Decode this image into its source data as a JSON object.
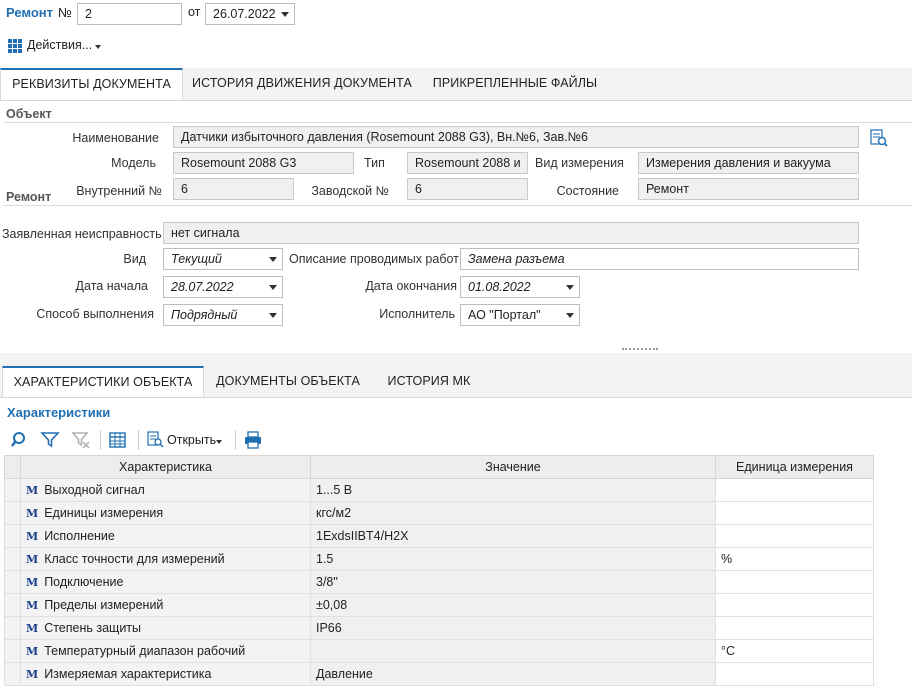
{
  "header": {
    "title": "Ремонт",
    "number_label": "№",
    "number_value": "2",
    "from_label": "от",
    "date_value": "26.07.2022",
    "actions_label": "Действия..."
  },
  "main_tabs": [
    "РЕКВИЗИТЫ ДОКУМЕНТА",
    "ИСТОРИЯ ДВИЖЕНИЯ ДОКУМЕНТА",
    "ПРИКРЕПЛЕННЫЕ ФАЙЛЫ"
  ],
  "object": {
    "section_title": "Объект",
    "name_label": "Наименование",
    "name_value": "Датчики избыточного давления (Rosemount 2088 G3), Вн.№6, Зав.№6",
    "model_label": "Модель",
    "model_value": "Rosemount 2088 G3",
    "type_label": "Тип",
    "type_value": "Rosemount 2088 и",
    "measure_label": "Вид измерения",
    "measure_value": "Измерения давления и вакуума",
    "internal_label": "Внутренний №",
    "internal_value": "6",
    "factory_label": "Заводской №",
    "factory_value": "6",
    "state_label": "Состояние",
    "state_value": "Ремонт"
  },
  "repair": {
    "section_title": "Ремонт",
    "fault_label": "Заявленная неисправность",
    "fault_value": "нет сигнала",
    "kind_label": "Вид",
    "kind_value": "Текущий",
    "work_label": "Описание проводимых работ",
    "work_value": "Замена разъема",
    "start_label": "Дата начала",
    "start_value": "28.07.2022",
    "end_label": "Дата окончания",
    "end_value": "01.08.2022",
    "method_label": "Способ выполнения",
    "method_value": "Подрядный",
    "executor_label": "Исполнитель",
    "executor_value": "АО \"Портал\""
  },
  "sub_tabs": [
    "ХАРАКТЕРИСТИКИ ОБЪЕКТА",
    "ДОКУМЕНТЫ ОБЪЕКТА",
    "ИСТОРИЯ МК"
  ],
  "characteristics": {
    "title": "Характеристики",
    "open_label": "Открыть",
    "row_marker": "M",
    "columns": [
      "Характеристика",
      "Значение",
      "Единица измерения"
    ],
    "rows": [
      {
        "name": "Выходной сигнал",
        "value": "1...5 В",
        "unit": ""
      },
      {
        "name": "Единицы измерения",
        "value": "кгс/м2",
        "unit": ""
      },
      {
        "name": "Исполнение",
        "value": "1ExdsIIBT4/H2X",
        "unit": ""
      },
      {
        "name": "Класс точности для измерений",
        "value": "1.5",
        "unit": "%"
      },
      {
        "name": "Подключение",
        "value": "3/8\"",
        "unit": ""
      },
      {
        "name": "Пределы измерений",
        "value": "±0,08",
        "unit": ""
      },
      {
        "name": "Степень защиты",
        "value": "IP66",
        "unit": ""
      },
      {
        "name": "Температурный диапазон рабочий",
        "value": "",
        "unit": "°С"
      },
      {
        "name": "Измеряемая характеристика",
        "value": "Давление",
        "unit": ""
      }
    ]
  },
  "colors": {
    "accent": "#1f6fb2",
    "marker": "#1a3f8a"
  }
}
